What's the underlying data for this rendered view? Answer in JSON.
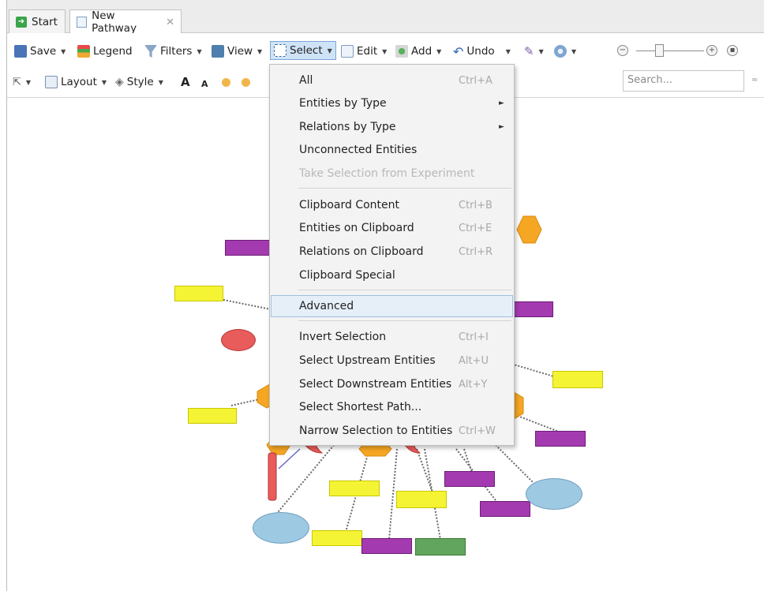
{
  "tabs": [
    {
      "label": "Start",
      "icon": "start-arrow-icon"
    },
    {
      "label": "New Pathway",
      "icon": "pathway-doc-icon",
      "close": "✕"
    }
  ],
  "toolbar": {
    "row1": {
      "save": "Save",
      "legend": "Legend",
      "filters": "Filters",
      "view": "View",
      "select": "Select",
      "edit": "Edit",
      "add": "Add",
      "undo": "Undo"
    },
    "row2": {
      "layout": "Layout",
      "style": "Style",
      "font_increase": "A",
      "font_decrease": "A"
    },
    "search": {
      "placeholder": "Search..."
    },
    "zoom": {
      "level": 0.35
    }
  },
  "select_menu": {
    "items": [
      {
        "label": "All",
        "shortcut": "Ctrl+A"
      },
      {
        "label": "Entities by Type",
        "submenu": "►"
      },
      {
        "label": "Relations by Type",
        "submenu": "►"
      },
      {
        "label": "Unconnected Entities"
      },
      {
        "label": "Take Selection from Experiment",
        "disabled": true
      },
      {
        "label": "Clipboard Content",
        "shortcut": "Ctrl+B"
      },
      {
        "label": "Entities on Clipboard",
        "shortcut": "Ctrl+E"
      },
      {
        "label": "Relations on Clipboard",
        "shortcut": "Ctrl+R"
      },
      {
        "label": "Clipboard Special"
      },
      {
        "label": "Advanced",
        "highlighted": true
      },
      {
        "label": "Invert Selection",
        "shortcut": "Ctrl+I"
      },
      {
        "label": "Select Upstream Entities",
        "shortcut": "Alt+U"
      },
      {
        "label": "Select Downstream Entities",
        "shortcut": "Alt+Y"
      },
      {
        "label": "Select Shortest Path..."
      },
      {
        "label": "Narrow Selection to Entities",
        "shortcut": "Ctrl+W"
      }
    ]
  },
  "colors": {
    "yellow_node": "#f4f434",
    "purple_node": "#a43ab0",
    "green_node": "#62a55e",
    "blue_node": "#9ec9e3",
    "red_node": "#e85c5c",
    "orange_hub": "#f5a623",
    "menu_highlight": "#e6eff8"
  }
}
